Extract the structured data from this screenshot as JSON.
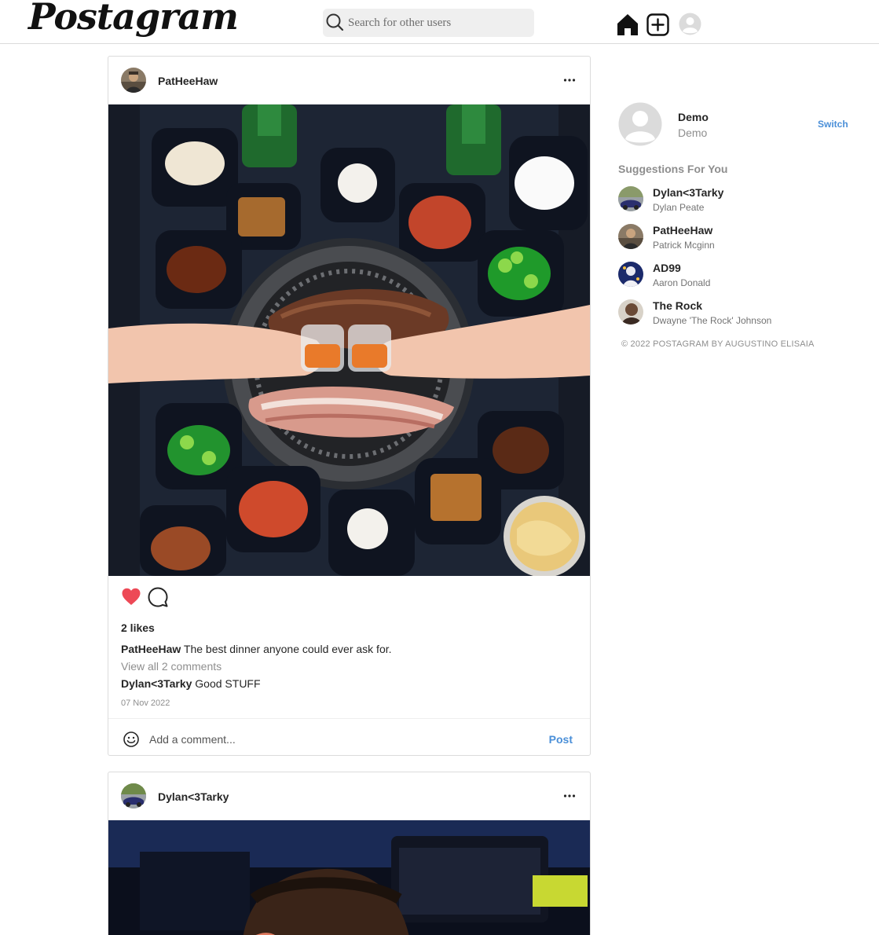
{
  "nav": {
    "logo": "Postagram",
    "search_placeholder": "Search for other users"
  },
  "posts": [
    {
      "username": "PatHeeHaw",
      "likes": "2 likes",
      "caption_user": "PatHeeHaw",
      "caption_text": "The best dinner anyone could ever ask for.",
      "view_all": "View all 2 comments",
      "comment_user": "Dylan<3Tarky",
      "comment_text": "Good STUFF",
      "date": "07 Nov 2022",
      "liked": true,
      "comment_placeholder": "Add a comment...",
      "post_label": "Post"
    },
    {
      "username": "Dylan<3Tarky"
    }
  ],
  "sidebar": {
    "username": "Demo",
    "name": "Demo",
    "switch_label": "Switch",
    "suggestions_title": "Suggestions For You",
    "suggestions": [
      {
        "username": "Dylan<3Tarky",
        "name": "Dylan Peate"
      },
      {
        "username": "PatHeeHaw",
        "name": "Patrick Mcginn"
      },
      {
        "username": "AD99",
        "name": "Aaron Donald"
      },
      {
        "username": "The Rock",
        "name": "Dwayne 'The Rock' Johnson"
      }
    ],
    "copyright": "© 2022 POSTAGRAM BY AUGUSTINO ELISAIA"
  },
  "colors": {
    "accent": "#4a8fd8",
    "like": "#ed4956",
    "border": "#dbdbdb"
  }
}
